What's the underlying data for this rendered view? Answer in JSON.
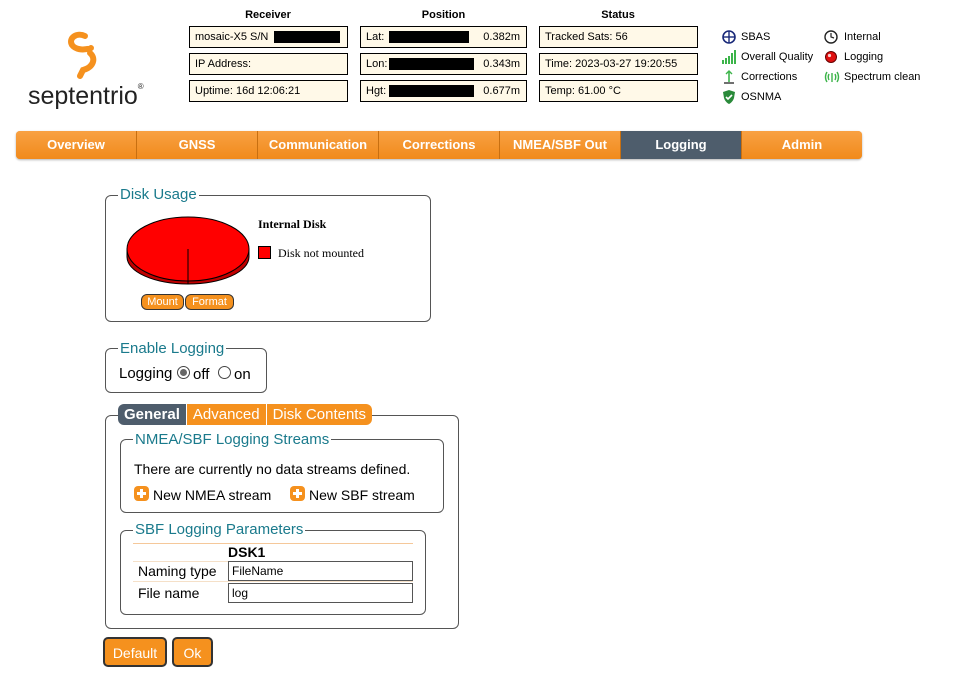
{
  "brand": {
    "name": "septentrio"
  },
  "header": {
    "receiver_title": "Receiver",
    "position_title": "Position",
    "status_title": "Status",
    "receiver": {
      "model": "mosaic-X5 S/N",
      "ip": "IP Address:",
      "uptime": "Uptime: 16d 12:06:21"
    },
    "position": {
      "lat_label": "Lat:",
      "lat_acc": "0.382m",
      "lon_label": "Lon:",
      "lon_acc": "0.343m",
      "hgt_label": "Hgt:",
      "hgt_acc": "0.677m"
    },
    "status": {
      "tracked": "Tracked Sats: 56",
      "time": "Time: 2023-03-27 19:20:55",
      "temp": "Temp: 61.00 °C"
    }
  },
  "legend": {
    "sbas": "SBAS",
    "quality": "Overall Quality",
    "corrections": "Corrections",
    "osnma": "OSNMA",
    "internal": "Internal",
    "logging": "Logging",
    "spectrum": "Spectrum clean"
  },
  "nav": {
    "tabs": [
      "Overview",
      "GNSS",
      "Communication",
      "Corrections",
      "NMEA/SBF Out",
      "Logging",
      "Admin"
    ],
    "active": "Logging"
  },
  "disk_usage": {
    "title": "Disk Usage",
    "disk_name": "Internal Disk",
    "status": "Disk not mounted",
    "mount_label": "Mount",
    "format_label": "Format",
    "status_color": "#ff0000"
  },
  "enable_logging": {
    "title": "Enable Logging",
    "label": "Logging",
    "off_label": "off",
    "on_label": "on",
    "selected": "off"
  },
  "subtabs": {
    "general": "General",
    "advanced": "Advanced",
    "disk_contents": "Disk Contents"
  },
  "streams": {
    "title": "NMEA/SBF Logging Streams",
    "empty_text": "There are currently no data streams defined.",
    "new_nmea": "New NMEA stream",
    "new_sbf": "New SBF stream"
  },
  "sbf_params": {
    "title": "SBF Logging Parameters",
    "column": "DSK1",
    "naming_label": "Naming type",
    "naming_value": "FileName",
    "file_label": "File name",
    "file_value": "log"
  },
  "buttons": {
    "default": "Default",
    "ok": "Ok"
  }
}
